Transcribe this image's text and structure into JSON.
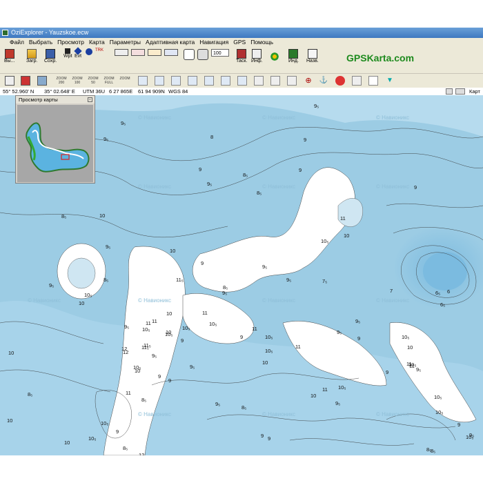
{
  "window": {
    "title": "OziExplorer - Yauzskoe.ecw"
  },
  "menu": [
    "Файл",
    "Выбрать",
    "Просмотр",
    "Карта",
    "Параметры",
    "Адаптивная карта",
    "Навигация",
    "GPS",
    "Помощь"
  ],
  "toolbar": {
    "exit": "Вы...",
    "load": "Загр.",
    "save": "Сохр.",
    "wpt": "Wpt",
    "evt": "Evt",
    "trk": "TRK",
    "zoom_value": "100",
    "task": "Таск.",
    "info": "Инф.",
    "ind": "Инд.",
    "names": "Назв."
  },
  "toolbar2": {
    "zoom_labels": [
      "ZOOM 200",
      "ZOOM 100",
      "ZOOM 50",
      "ZOOM FULL",
      "ZOOM"
    ]
  },
  "brand": "GPSKarta.com",
  "status": {
    "lat": "55° 52.960' N",
    "lon": "35° 02.648' E",
    "utm": "UTM  36U",
    "easting": "6 27 865E",
    "northing": "61 94 909N",
    "datum": "WGS 84",
    "right": "Карт"
  },
  "overview": {
    "title": "Просмотр карты"
  },
  "watermark": "© Навионикс",
  "colors": {
    "land": "#ffffff",
    "shallow": "#cfe6f2",
    "mid": "#a7d3ea",
    "deep": "#8fc6e4",
    "deepest": "#7bbbe0",
    "brand": "#1d8a1d"
  },
  "depths": [
    {
      "t": "9₅"
    },
    {
      "t": "9"
    },
    {
      "t": "9₅"
    },
    {
      "t": "8"
    },
    {
      "t": "9₅"
    },
    {
      "t": "9"
    },
    {
      "t": "8₅"
    },
    {
      "t": "9"
    },
    {
      "t": "8₅"
    },
    {
      "t": "9₅"
    },
    {
      "t": "9"
    },
    {
      "t": "10"
    },
    {
      "t": "8₅"
    },
    {
      "t": "9₅"
    },
    {
      "t": "11"
    },
    {
      "t": "10"
    },
    {
      "t": "9₅"
    },
    {
      "t": "10₅"
    },
    {
      "t": "10"
    },
    {
      "t": "9"
    },
    {
      "t": "10₅"
    },
    {
      "t": "9₅"
    },
    {
      "t": "11₅"
    },
    {
      "t": "8₅"
    },
    {
      "t": "7₅"
    },
    {
      "t": "7"
    },
    {
      "t": "6₅"
    },
    {
      "t": "9₅"
    },
    {
      "t": "10₅"
    },
    {
      "t": "10"
    },
    {
      "t": "11"
    },
    {
      "t": "10"
    },
    {
      "t": "9₅"
    },
    {
      "t": "11"
    },
    {
      "t": "10₅"
    },
    {
      "t": "11"
    },
    {
      "t": "10₅"
    },
    {
      "t": "10"
    },
    {
      "t": "9₅"
    },
    {
      "t": "9"
    },
    {
      "t": "11"
    },
    {
      "t": "9"
    },
    {
      "t": "10₅"
    },
    {
      "t": "9"
    },
    {
      "t": "10₅"
    },
    {
      "t": "11"
    },
    {
      "t": "10"
    },
    {
      "t": "9₅"
    },
    {
      "t": "8₅"
    },
    {
      "t": "12"
    },
    {
      "t": "11₅"
    },
    {
      "t": "10₅"
    },
    {
      "t": "11"
    },
    {
      "t": "10"
    },
    {
      "t": "9"
    },
    {
      "t": "9₅"
    },
    {
      "t": "10₅"
    },
    {
      "t": "11"
    },
    {
      "t": "10"
    },
    {
      "t": "9"
    },
    {
      "t": "10₅"
    },
    {
      "t": "11"
    },
    {
      "t": "10"
    },
    {
      "t": "10₅"
    },
    {
      "t": "9₅"
    },
    {
      "t": "8₅"
    },
    {
      "t": "9"
    },
    {
      "t": "9₅"
    },
    {
      "t": "10₅"
    },
    {
      "t": "10"
    },
    {
      "t": "9"
    },
    {
      "t": "12"
    },
    {
      "t": "9"
    },
    {
      "t": "10"
    },
    {
      "t": "9₅"
    },
    {
      "t": "8₅"
    },
    {
      "t": "7₅"
    },
    {
      "t": "8₅"
    },
    {
      "t": "9₅"
    },
    {
      "t": "8₅"
    },
    {
      "t": "10₅"
    },
    {
      "t": "10₅"
    },
    {
      "t": "9"
    },
    {
      "t": "9"
    },
    {
      "t": "8₅"
    },
    {
      "t": "10₅"
    },
    {
      "t": "9₅"
    },
    {
      "t": "9₅"
    },
    {
      "t": "10₅"
    },
    {
      "t": "6"
    },
    {
      "t": "6₅"
    },
    {
      "t": "8₅"
    },
    {
      "t": "10₅"
    },
    {
      "t": "8₅"
    },
    {
      "t": "12"
    },
    {
      "t": "11"
    },
    {
      "t": "9₅"
    },
    {
      "t": "10"
    },
    {
      "t": "11₅"
    }
  ]
}
